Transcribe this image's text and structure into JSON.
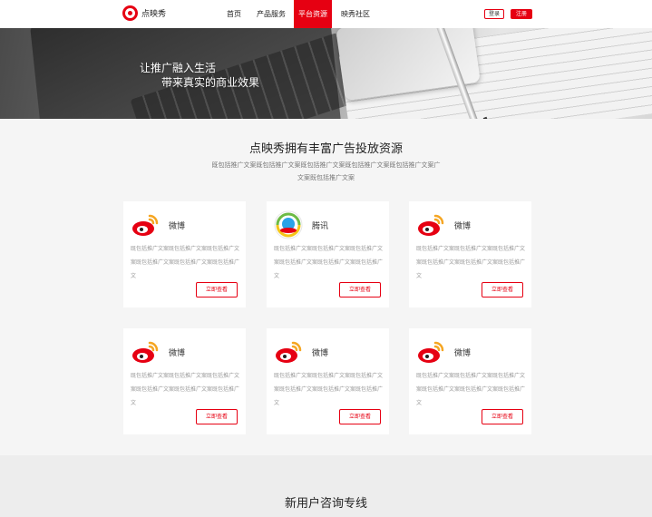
{
  "header": {
    "logo_text": "点映秀",
    "nav": [
      "首页",
      "产品服务",
      "平台资源",
      "映秀社区"
    ],
    "active_nav_index": 2,
    "login_label": "登录",
    "register_label": "注册"
  },
  "banner": {
    "slogan_line1": "让推广融入生活",
    "slogan_line2": "带来真实的商业效果"
  },
  "resources": {
    "title": "点映秀拥有丰富广告投放资源",
    "description": "既包括推广文案既包括推广文案既包括推广文案既包括推广文案既包括推广文案广文案既包括推广文案",
    "cards": [
      {
        "name": "微博",
        "icon": "weibo-icon",
        "text": "既包括推广文案既包括推广文案既包括推广文案既包括推广文案既包括推广文案既包括推广文",
        "button": "立即查看"
      },
      {
        "name": "腾讯",
        "icon": "tencent-icon",
        "text": "既包括推广文案既包括推广文案既包括推广文案既包括推广文案既包括推广文案既包括推广文",
        "button": "立即查看"
      },
      {
        "name": "微博",
        "icon": "weibo-icon",
        "text": "既包括推广文案既包括推广文案既包括推广文案既包括推广文案既包括推广文案既包括推广文",
        "button": "立即查看"
      },
      {
        "name": "微博",
        "icon": "weibo-icon",
        "text": "既包括推广文案既包括推广文案既包括推广文案既包括推广文案既包括推广文案既包括推广文",
        "button": "立即查看"
      },
      {
        "name": "微博",
        "icon": "weibo-icon",
        "text": "既包括推广文案既包括推广文案既包括推广文案既包括推广文案既包括推广文案既包括推广文",
        "button": "立即查看"
      },
      {
        "name": "微博",
        "icon": "weibo-icon",
        "text": "既包括推广文案既包括推广文案既包括推广文案既包括推广文案既包括推广文案既包括推广文",
        "button": "立即查看"
      }
    ]
  },
  "consult": {
    "title": "新用户咨询专线"
  },
  "colors": {
    "brand_red": "#e60012",
    "weibo_orange": "#f5a623",
    "tencent_blue": "#2aa3e8",
    "tencent_green": "#6dbb45"
  }
}
